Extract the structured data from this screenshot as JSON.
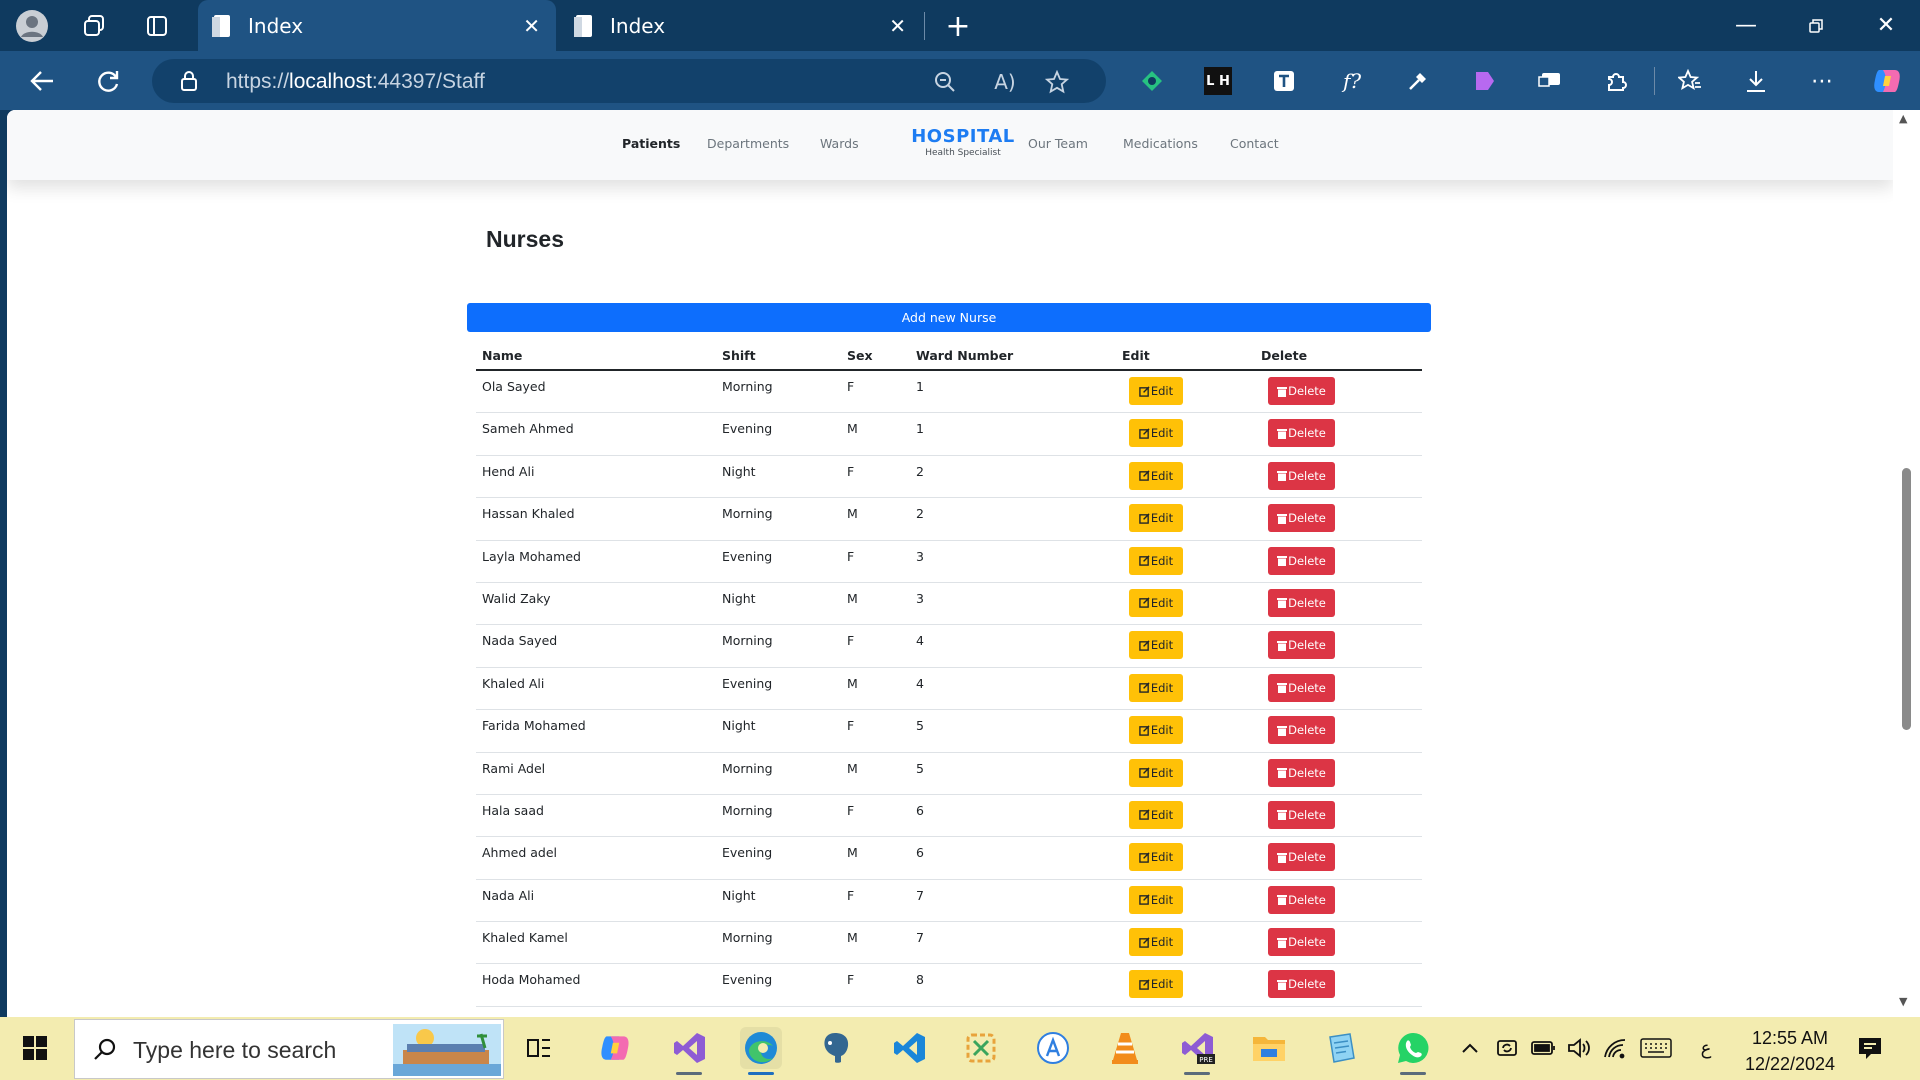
{
  "browser": {
    "tabs": [
      {
        "title": "Index",
        "active": true
      },
      {
        "title": "Index",
        "active": false
      }
    ],
    "url_scheme": "https://",
    "url_host": "localhost",
    "url_rest": ":44397/Staff",
    "ext_lh_label": "L H"
  },
  "navbar": {
    "links_left": [
      "Patients",
      "Departments",
      "Wards"
    ],
    "brand_title": "HOSPITAL",
    "brand_subtitle": "Health Specialist",
    "links_right": [
      "Our Team",
      "Medications",
      "Contact"
    ],
    "active_link": "Patients"
  },
  "page": {
    "heading": "Nurses",
    "add_button_label": "Add new Nurse",
    "table_headers": [
      "Name",
      "Shift",
      "Sex",
      "Ward Number",
      "Edit",
      "Delete"
    ],
    "edit_label": "Edit",
    "delete_label": "Delete",
    "rows": [
      {
        "name": "Ola Sayed",
        "shift": "Morning",
        "sex": "F",
        "ward": "1"
      },
      {
        "name": "Sameh Ahmed",
        "shift": "Evening",
        "sex": "M",
        "ward": "1"
      },
      {
        "name": "Hend Ali",
        "shift": "Night",
        "sex": "F",
        "ward": "2"
      },
      {
        "name": "Hassan Khaled",
        "shift": "Morning",
        "sex": "M",
        "ward": "2"
      },
      {
        "name": "Layla Mohamed",
        "shift": "Evening",
        "sex": "F",
        "ward": "3"
      },
      {
        "name": "Walid Zaky",
        "shift": "Night",
        "sex": "M",
        "ward": "3"
      },
      {
        "name": "Nada Sayed",
        "shift": "Morning",
        "sex": "F",
        "ward": "4"
      },
      {
        "name": "Khaled Ali",
        "shift": "Evening",
        "sex": "M",
        "ward": "4"
      },
      {
        "name": "Farida Mohamed",
        "shift": "Night",
        "sex": "F",
        "ward": "5"
      },
      {
        "name": "Rami Adel",
        "shift": "Morning",
        "sex": "M",
        "ward": "5"
      },
      {
        "name": "Hala saad",
        "shift": "Morning",
        "sex": "F",
        "ward": "6"
      },
      {
        "name": "Ahmed adel",
        "shift": "Evening",
        "sex": "M",
        "ward": "6"
      },
      {
        "name": "Nada Ali",
        "shift": "Night",
        "sex": "F",
        "ward": "7"
      },
      {
        "name": "Khaled Kamel",
        "shift": "Morning",
        "sex": "M",
        "ward": "7"
      },
      {
        "name": "Hoda Mohamed",
        "shift": "Evening",
        "sex": "F",
        "ward": "8"
      }
    ]
  },
  "taskbar": {
    "search_placeholder": "Type here to search",
    "time": "12:55 AM",
    "date": "12/22/2024",
    "lang_indicator": "ع"
  },
  "colors": {
    "primary": "#0d6efd",
    "warning": "#ffc107",
    "danger": "#dc3545",
    "brand": "#1d7cf2",
    "chrome_dark": "#0f3a5f",
    "chrome_toolbar": "#1f5383",
    "taskbar": "#f3ecb0"
  }
}
